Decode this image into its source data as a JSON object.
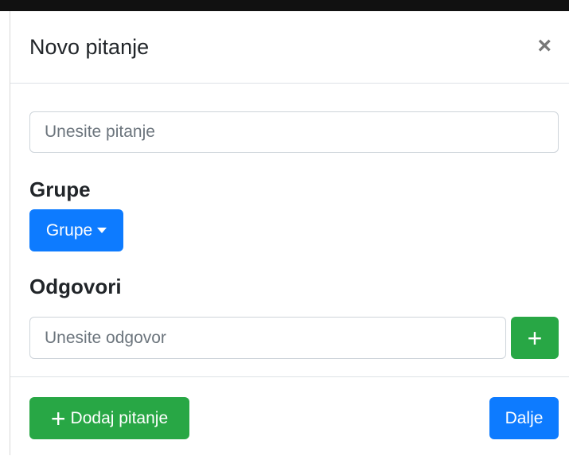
{
  "modal": {
    "title": "Novo pitanje",
    "close_glyph": "×"
  },
  "question": {
    "placeholder": "Unesite pitanje",
    "value": ""
  },
  "groups": {
    "heading": "Grupe",
    "dropdown_label": "Grupe"
  },
  "answers": {
    "heading": "Odgovori",
    "placeholder": "Unesite odgovor",
    "value": "",
    "add_glyph": "+"
  },
  "footer": {
    "add_question_glyph": "+",
    "add_question_label": "Dodaj pitanje",
    "next_label": "Dalje"
  },
  "colors": {
    "primary": "#0d7bff",
    "success": "#28a745",
    "border": "#ced4da"
  },
  "icons": {
    "close": "close-icon",
    "caret": "caret-down-icon",
    "plus": "plus-icon"
  }
}
